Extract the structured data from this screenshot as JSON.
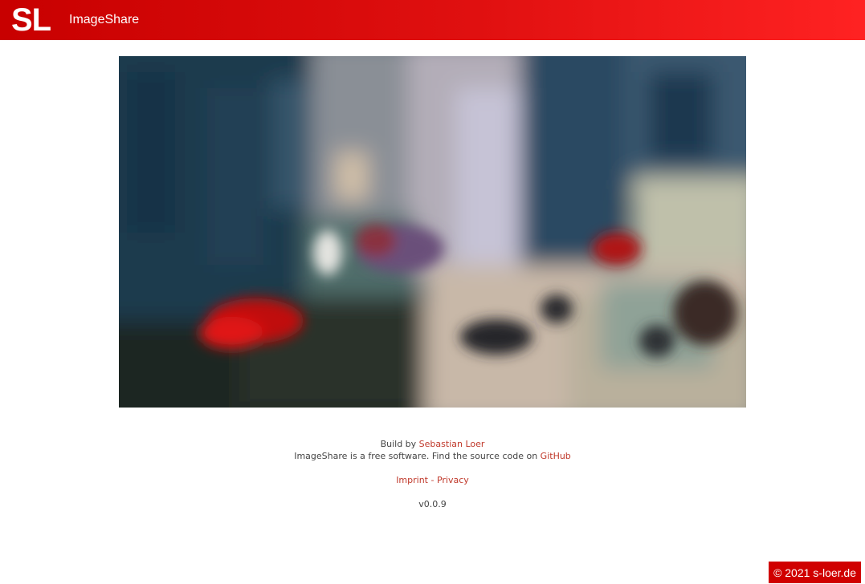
{
  "header": {
    "logo_text": "SL",
    "app_title": "ImageShare"
  },
  "image": {
    "alt": "Shared image (blurred street scene)"
  },
  "footer": {
    "build_prefix": "Build by ",
    "author_link": "Sebastian Loer",
    "source_text": "ImageShare is a free software. Find the source code on ",
    "github_link": "GitHub",
    "imprint_link": "Imprint",
    "separator": " - ",
    "privacy_link": "Privacy",
    "version": "v0.0.9"
  },
  "copyright": {
    "text": "© 2021 s-loer.de"
  },
  "colors": {
    "header_start": "#c80000",
    "header_end": "#ff2222",
    "link": "#c0392b",
    "copyright_bg": "#d00000"
  }
}
